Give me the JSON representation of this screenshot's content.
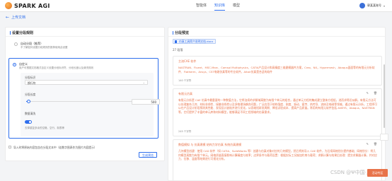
{
  "header": {
    "logo_text": "SPARK AGI",
    "nav": [
      "智能体",
      "知识库",
      "模型"
    ],
    "active_nav": "知识库",
    "user_name": "郭某某账号"
  },
  "back": {
    "arrow": "←",
    "label": "上传文档"
  },
  "left_panel": {
    "title": "设置分段规则",
    "option_auto": {
      "title": "自动分段（推荐）",
      "desc": "不了解如何设置分段规则的推荐使用此设置"
    },
    "option_custom": {
      "title": "自定义",
      "desc": "用户可根据文档格式自定义设置分段标识符、分段长度以及清洗规则",
      "sep_label": "分段标识",
      "sep_value": "换行符",
      "len_label": "分段长度",
      "len_value": "500",
      "len_fraction": 0.02,
      "clean_label": "数据清洗",
      "clean_desc": "去掉重复多余的空格、空行、制表等"
    },
    "checkbox_label": "导入时将原始内容包含在分段文本中（若数字图表作为图片内容提示）",
    "action_label": "生成预览"
  },
  "right_panel": {
    "title": "分段预览",
    "file_name": "仿真工具简介说明文档.docx",
    "count": "27 段落",
    "segments": [
      {
        "title": "主流CAE 软件",
        "body": "NASTRAN、Fluent、MSC.Marc、Comsol Multiphysics、CATIA产品设计和高精度三维建模器件方案，Creo、NX，Hypermesh、Abaqus面面等的有限元分析软件、Flotherm、Ansys、CST电磁仿真等的专业软件，Altair仿真是合适的软件",
        "meta": "140 个字符"
      },
      {
        "title": "有限元仿真",
        "body": "有限元分析是 CAE 仿真中最重要的一种数值方法，它将连续的求解域离散为有限个单元的组合，通过单元方程的集成建立整体方程组，进而求得近似解。有限元方法可以处理复杂几何、材料非线性、接触非线性以及多物理场耦合问题，广泛应用于结构强度、刚度、振动、疲劳、热传导、流体及电磁等领域。通过有限元分析，工程师可以在产品设计阶段预测其性能、发现设计缺陷并进行优化，从而缩短研发周期、降低试验成本、提高产品质量。常用的有限元软件包括 ANSYS、Abaqus、NASTRAN 等，它们提供了丰富的单元库和材料模型，能够满足不同工程领域的仿真需求。",
        "meta": "245 个字符"
      },
      {
        "title": "数值模拟 与 仿真建模 结构力学仿真 系统仿真建模",
        "body": "几何模型创建：使用 CAD 软件（如 CATIA、SolidWorks 等）创建与仿真对象对应的几何模型，然后将其导入 CAE 软件，为后续网格划分提供基础；网格划分：将几何模型离散为有限个单元，网格质量直接影响计算精度与效率；边界条件与载荷设置：根据实际工况施加约束与载荷；求解计算与结果后处理：提交求解器计算，并对应力、位移、温度等结果进行可视化分析。",
        "meta": ""
      }
    ]
  },
  "watermark": "CSDN @Ψ中国·凡",
  "corner_badge": "活动专区"
}
